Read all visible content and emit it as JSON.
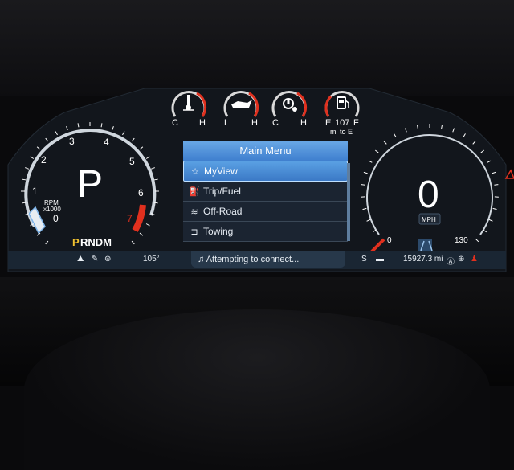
{
  "gauges": {
    "temp": {
      "low": "C",
      "high": "H",
      "icon": "coolant-temp-icon"
    },
    "oil": {
      "low": "L",
      "high": "H",
      "icon": "oil-pressure-icon"
    },
    "trans": {
      "low": "C",
      "high": "H",
      "icon": "transmission-temp-icon"
    },
    "fuel": {
      "low": "E",
      "value": "107",
      "high": "F",
      "sub": "mi to E",
      "icon": "fuel-pump-icon"
    }
  },
  "tach": {
    "gear": "P",
    "label1": "RPM",
    "label2": "x1000",
    "ticks": [
      "0",
      "1",
      "2",
      "3",
      "4",
      "5",
      "6",
      "7"
    ],
    "gear_selector": {
      "active": "P",
      "rest": "RNDM"
    }
  },
  "speedo": {
    "speed": "0",
    "unit": "MPH",
    "min": "0",
    "max": "130"
  },
  "menu": {
    "title": "Main Menu",
    "items": [
      {
        "label": "MyView",
        "icon": "star-icon",
        "selected": true
      },
      {
        "label": "Trip/Fuel",
        "icon": "fuel-pump-icon",
        "selected": false
      },
      {
        "label": "Off-Road",
        "icon": "off-road-icon",
        "selected": false
      },
      {
        "label": "Towing",
        "icon": "trailer-icon",
        "selected": false
      }
    ]
  },
  "status": {
    "outside_temp": "105°",
    "media": "Attempting to connect...",
    "mode": "S",
    "odometer": "15927.3 mi"
  },
  "colors": {
    "accent": "#3f7fcf",
    "redline": "#e0301e",
    "gear_active": "#f2c230",
    "background": "#1a2633"
  }
}
